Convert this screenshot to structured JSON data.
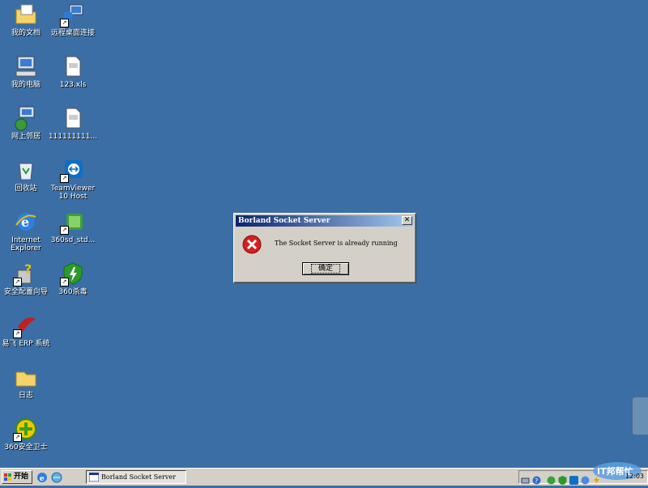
{
  "desktop": {
    "icons": [
      {
        "label": "我的文档"
      },
      {
        "label": "远程桌面连接"
      },
      {
        "label": "我的电脑"
      },
      {
        "label": "123.xls"
      },
      {
        "label": "网上邻居"
      },
      {
        "label": "111111111..."
      },
      {
        "label": "回收站"
      },
      {
        "label": "TeamViewer 10 Host"
      },
      {
        "label": "Internet Explorer"
      },
      {
        "label": "360sd_std..."
      },
      {
        "label": "安全配置向导"
      },
      {
        "label": "360杀毒"
      },
      {
        "label": "易飞 ERP 系统"
      },
      {
        "label": "日志"
      },
      {
        "label": "360安全卫士"
      }
    ]
  },
  "dialog": {
    "title": "Borland Socket Server",
    "close_label": "✕",
    "message": "The Socket Server is already running",
    "ok_label": "确定"
  },
  "taskbar": {
    "start_label": "开始",
    "task_title": "Borland Socket Server",
    "clock": "12:03",
    "watermark": "IT邦帮忙"
  },
  "colors": {
    "desktop": "#3a6ea5",
    "titlebar_start": "#0a246a",
    "titlebar_end": "#a6caf0",
    "error_red": "#d42020"
  }
}
